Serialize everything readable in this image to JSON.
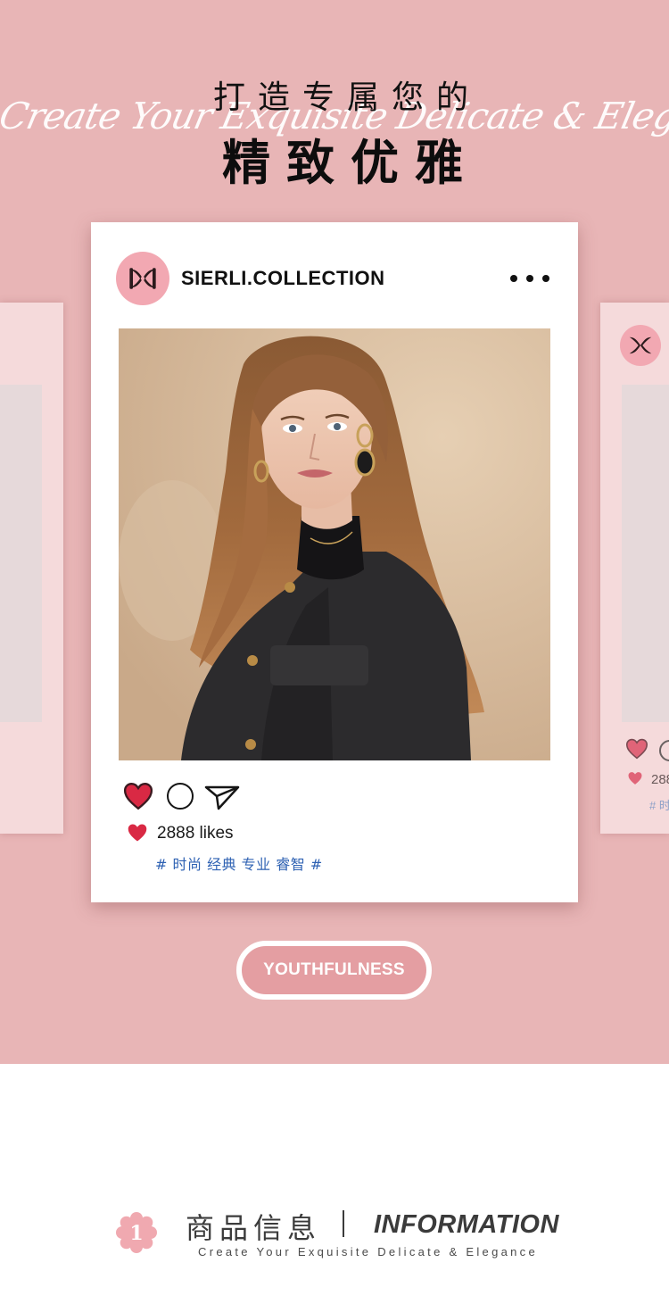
{
  "header": {
    "script_text": "Create Your Exquisite Delicate & Elegance",
    "title_small": "打造专属您的",
    "title_big": "精致优雅"
  },
  "post": {
    "account_name": "SIERLI.COLLECTION",
    "likes": "2888 likes",
    "tags": "# 时尚 经典 专业 睿智 #",
    "logo_icon": "brand-monogram-icon",
    "more_icon": "more-dots-icon",
    "like_icon": "heart-icon",
    "comment_icon": "comment-circle-icon",
    "share_icon": "paper-plane-icon"
  },
  "side_card": {
    "likes_partial": "288",
    "tags_partial": "# 时"
  },
  "button": {
    "label": "YOUTHFULNESS"
  },
  "section": {
    "badge_number": "1",
    "title_cn": "商品信息",
    "title_en": "INFORMATION",
    "subtitle": "Create Your Exquisite Delicate & Elegance"
  },
  "colors": {
    "hero_background": "#e8b5b6",
    "card_background": "#ffffff",
    "side_card_background": "#f5dadb",
    "heart_red": "#d92944",
    "tag_blue": "#2f62b3",
    "avatar_pink": "#f2a8b2",
    "button_pink": "#e49ea2"
  }
}
